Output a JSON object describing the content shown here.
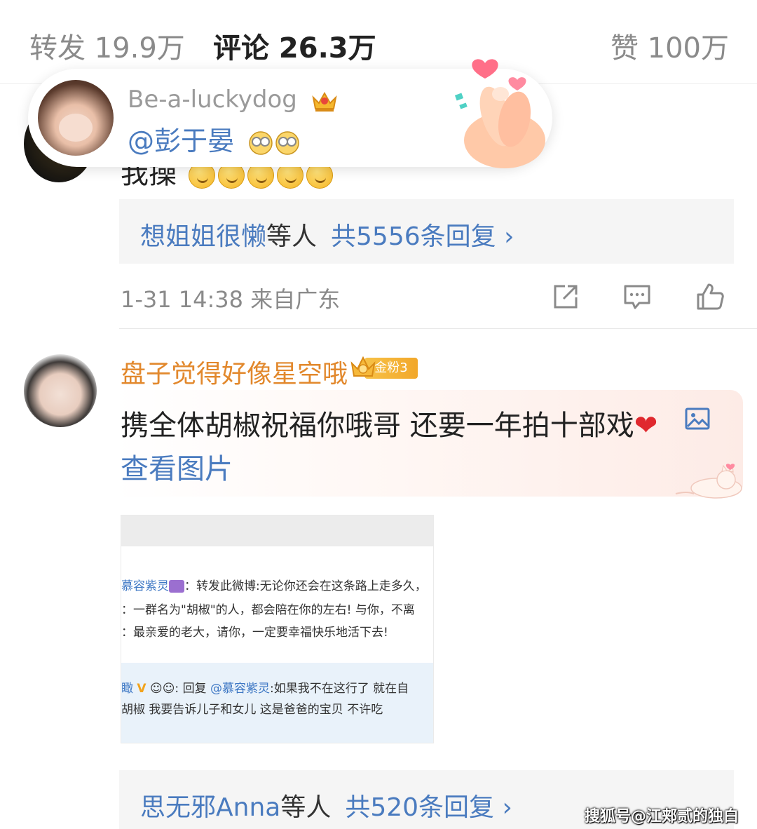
{
  "tabs": {
    "repost": "转发 19.9万",
    "comments": "评论 26.3万",
    "likes": "赞 100万"
  },
  "user_card": {
    "username": "Be-a-luckydog",
    "mention": "@彭于晏"
  },
  "comment_1": {
    "text": "我操",
    "reply_summary": {
      "names": "想姐姐很懒",
      "suffix": "等人",
      "count": "共5556条回复 ›"
    },
    "meta": "1-31 14:38  来自广东"
  },
  "comment_2": {
    "username": "盘子觉得好像星空哦",
    "fan_badge": "金粉3",
    "text": "携全体胡椒祝福你哦哥 还要一年拍十部戏",
    "view_image": "查看图片",
    "embedded_image": {
      "line1_name": "慕容紫灵",
      "line1_text": "：转发此微博:无论你还会在这条路上走多久，",
      "line2": "：一群名为\"胡椒\"的人，都会陪在你的左右! 与你，不离",
      "line3": "：最亲爱的老大，请你，一定要幸福快乐地活下去!",
      "line4_prefix": "回复",
      "line4_mention": "@慕容紫灵",
      "line4_text": ":如果我不在这行了 就在自",
      "line5": "胡椒 我要告诉儿子和女儿 这是爸爸的宝贝 不许吃"
    },
    "reply_summary": {
      "names": "思无邪Anna",
      "suffix": "等人",
      "count": "共520条回复 ›"
    }
  },
  "watermark": "搜狐号@江郏贰的独白",
  "colors": {
    "link_blue": "#4a7bbf",
    "vip_orange": "#e2882c",
    "meta_gray": "#8a8a8a",
    "heart_red": "#e0282e"
  },
  "icons": [
    "share-icon",
    "comment-icon",
    "like-icon",
    "crown-icon",
    "image-icon",
    "heart-hand-icon"
  ]
}
